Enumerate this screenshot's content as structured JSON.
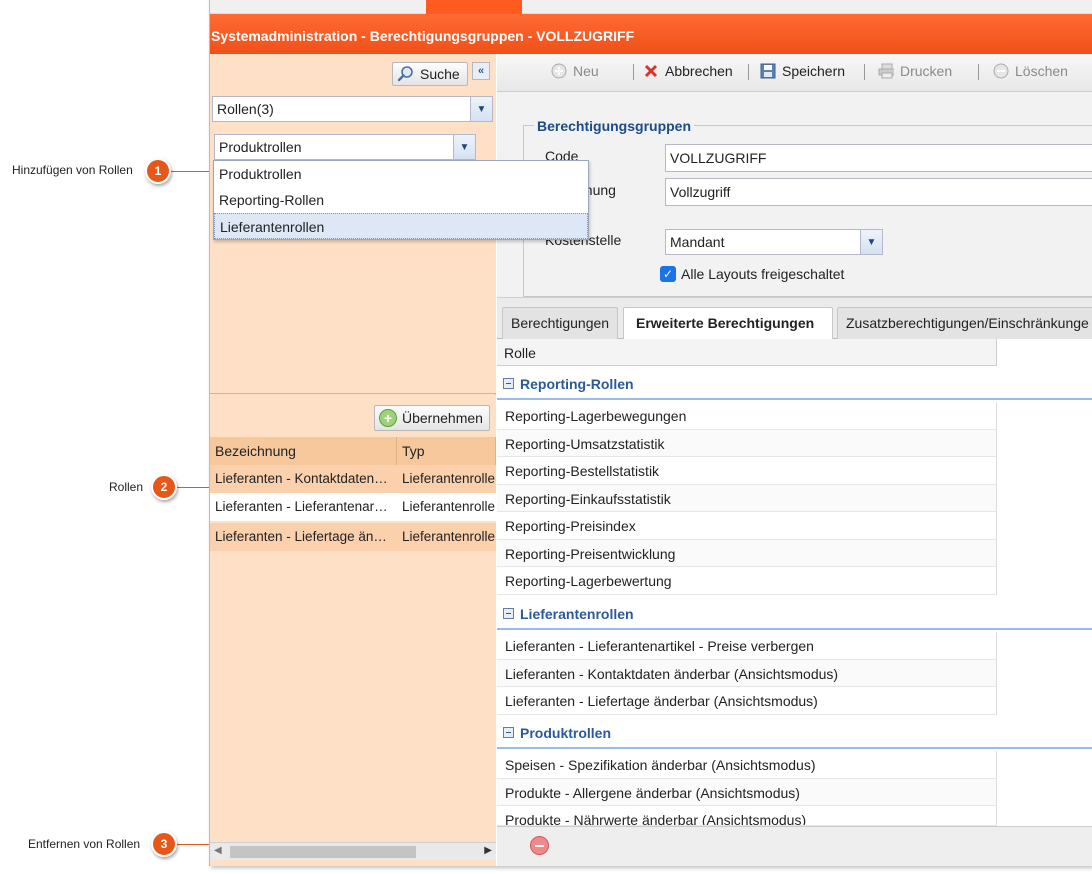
{
  "callouts": [
    {
      "number": "1",
      "label": "Hinzufügen von Rollen"
    },
    {
      "number": "2",
      "label": "Rollen"
    },
    {
      "number": "3",
      "label": "Entfernen von Rollen"
    }
  ],
  "window": {
    "title": "Systemadministration - Berechtigungsgruppen - VOLLZUGRIFF"
  },
  "left": {
    "search_label": "Suche",
    "collapse_glyph": "«",
    "roles_combo_value": "Rollen(3)",
    "roletype_combo_value": "Produktrollen",
    "dropdown_options": [
      "Produktrollen",
      "Reporting-Rollen",
      "Lieferantenrollen"
    ],
    "apply_label": "Übernehmen",
    "grid_columns": [
      "Bezeichnung",
      "Typ"
    ],
    "grid_rows": [
      {
        "name": "Lieferanten - Kontaktdaten…",
        "type": "Lieferantenrolle"
      },
      {
        "name": "Lieferanten - Lieferantenar…",
        "type": "Lieferantenrolle"
      },
      {
        "name": "Lieferanten - Liefertage än…",
        "type": "Lieferantenrolle"
      }
    ]
  },
  "toolbar": {
    "new_label": "Neu",
    "cancel_label": "Abbrechen",
    "save_label": "Speichern",
    "print_label": "Drucken",
    "delete_label": "Löschen"
  },
  "form": {
    "legend": "Berechtigungsgruppen",
    "code_label": "Code",
    "code_value": "VOLLZUGRIFF",
    "name_label_visible": "hnung",
    "name_value": "Vollzugriff",
    "cost_label_visible": "Kostenstelle",
    "cost_value": "Mandant",
    "layouts_label": "Alle Layouts freigeschaltet"
  },
  "tabs": [
    "Berechtigungen",
    "Erweiterte Berechtigungen",
    "Zusatzberechtigungen/Einschränkunge"
  ],
  "roles_grid": {
    "column": "Rolle",
    "groups": [
      {
        "name": "Reporting-Rollen",
        "rows": [
          "Reporting-Lagerbewegungen",
          "Reporting-Umsatzstatistik",
          "Reporting-Bestellstatistik",
          "Reporting-Einkaufsstatistik",
          "Reporting-Preisindex",
          "Reporting-Preisentwicklung",
          "Reporting-Lagerbewertung"
        ]
      },
      {
        "name": "Lieferantenrollen",
        "rows": [
          "Lieferanten - Lieferantenartikel - Preise verbergen",
          "Lieferanten - Kontaktdaten änderbar (Ansichtsmodus)",
          "Lieferanten - Liefertage änderbar (Ansichtsmodus)"
        ]
      },
      {
        "name": "Produktrollen",
        "rows": [
          "Speisen - Spezifikation änderbar (Ansichtsmodus)",
          "Produkte - Allergene änderbar (Ansichtsmodus)",
          "Produkte - Nährwerte änderbar (Ansichtsmodus)"
        ]
      }
    ]
  },
  "colors": {
    "accent": "#f05018",
    "callout": "#e8571a",
    "panel": "#fde0c6",
    "group_title": "#2c5a97"
  }
}
